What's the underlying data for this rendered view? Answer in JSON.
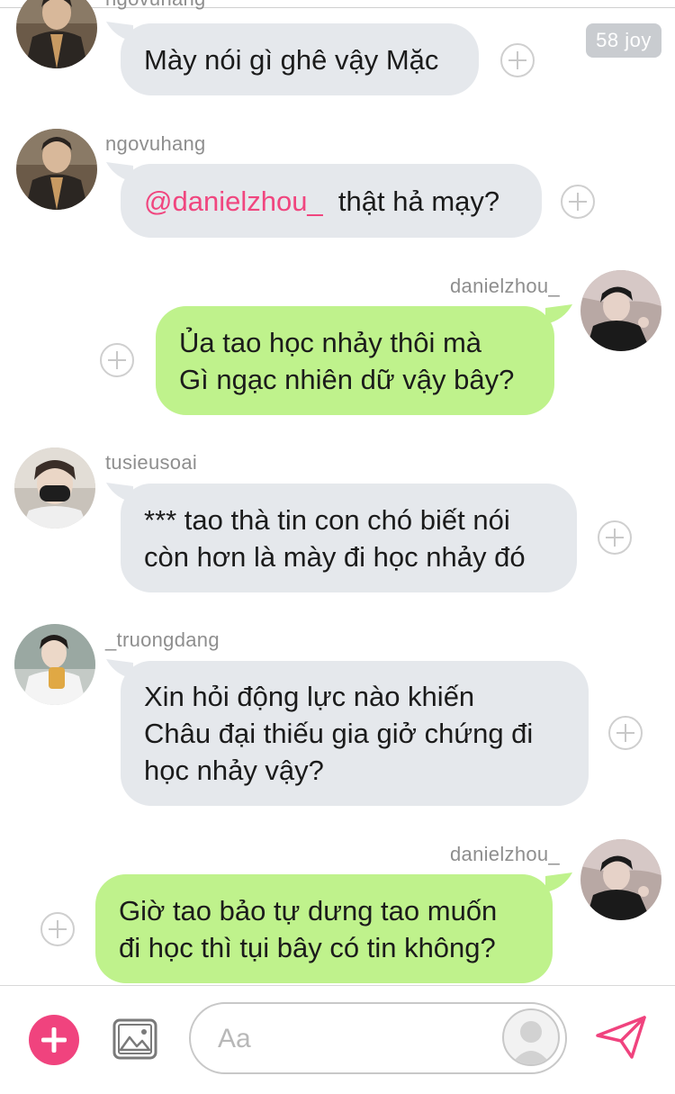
{
  "joy_badge": "58 joy",
  "messages": [
    {
      "username": "ngovuhang",
      "lines": [
        "Mày nói gì ghê vậy Mặc"
      ]
    },
    {
      "username": "ngovuhang",
      "mention": "@danielzhou_",
      "text": "thật hả mạy?"
    },
    {
      "username": "danielzhou_",
      "lines": [
        "Ủa tao học nhảy thôi mà",
        "Gì ngạc nhiên dữ vậy bây?"
      ]
    },
    {
      "username": "tusieusoai",
      "lines": [
        "*** tao thà tin con chó biết nói",
        "còn hơn là mày đi học nhảy đó"
      ]
    },
    {
      "username": "_truongdang",
      "lines": [
        "Xin hỏi động lực nào khiến",
        "Châu đại thiếu gia giở chứng đi",
        "học nhảy vậy?"
      ]
    },
    {
      "username": "danielzhou_",
      "lines": [
        "Giờ tao bảo tự dưng tao muốn",
        "đi học thì tụi bây có tin không?"
      ]
    }
  ],
  "composer": {
    "placeholder": "Aa"
  },
  "colors": {
    "incoming_bubble": "#e5e8ec",
    "outgoing_bubble": "#bff28c",
    "accent": "#f0437e",
    "mention": "#f0467f"
  },
  "icons": [
    "add-icon",
    "image-icon",
    "sticker-avatar-icon",
    "send-icon",
    "reaction-plus-icon"
  ]
}
